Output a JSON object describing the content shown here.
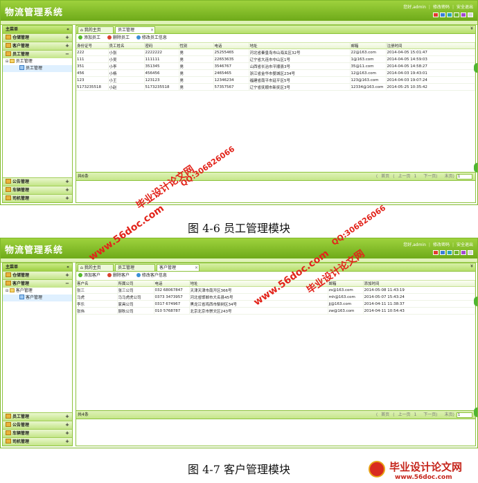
{
  "app_title": "物流管理系统",
  "top_links": {
    "welcome": "您好,admin",
    "change_password": "修改密码",
    "logout": "安全退出"
  },
  "skin_colors": [
    "#e23b2e",
    "#3b7fd9",
    "#2ba3b5",
    "#6db42b",
    "#a34ad0",
    "#d8d8d8"
  ],
  "menu_title": "主菜单",
  "menu_title_ctl": "«",
  "shot1": {
    "top_menus": [
      {
        "label": "仓储管理",
        "ctl": "+"
      },
      {
        "label": "客户管理",
        "ctl": "+"
      },
      {
        "label": "员工管理",
        "ctl": "−"
      }
    ],
    "tree": {
      "folder": "员工管理",
      "leaf": "员工管理"
    },
    "bottom_menus": [
      {
        "label": "公告管理",
        "ctl": "+"
      },
      {
        "label": "车辆管理",
        "ctl": "+"
      },
      {
        "label": "司机管理",
        "ctl": "+"
      }
    ],
    "tabs": [
      {
        "label": "我的主页"
      },
      {
        "label": "员工管理"
      }
    ],
    "toolbar": {
      "add": "添加员工",
      "delete": "删除员工",
      "edit": "修改员工信息"
    },
    "columns": [
      "身份证号",
      "员工姓名",
      "密码",
      "性别",
      "电话",
      "地址",
      "邮箱",
      "注册时间"
    ],
    "rows": [
      [
        "222",
        "小张",
        "2222222",
        "男",
        "25255465",
        "河北省秦皇岛市山海关区32号",
        "22@163.com",
        "2014-04-05 15:01:47"
      ],
      [
        "111",
        "小吴",
        "111111",
        "男",
        "22653635",
        "辽宁省大连市中山区1号",
        "1@163.com",
        "2014-04-05 14:59:03"
      ],
      [
        "351",
        "小李",
        "351345",
        "男",
        "3546767",
        "山西省长治市平顺县3号",
        "35@11.com",
        "2014-04-05 14:58:27"
      ],
      [
        "456",
        "小杨",
        "456456",
        "男",
        "2465465",
        "浙江省金华市婺城区234号",
        "12@163.com",
        "2014-04-03 19:43:01"
      ],
      [
        "123",
        "小王",
        "123123",
        "男",
        "12346234",
        "福建省南平市延平区5号",
        "123@163.com",
        "2014-04-03 19:07:24"
      ],
      [
        "5173235518",
        "小赵",
        "5173235518",
        "男",
        "57357567",
        "辽宁省抚顺市新抚区3号",
        "12334@163.com",
        "2014-05-25 10:35:42"
      ]
    ],
    "pager": {
      "total": "共6条",
      "first": "首页",
      "prev": "上一页",
      "page": "1",
      "next": "下一页",
      "last": "末页",
      "box": "1"
    }
  },
  "caption1": "图 4-6 员工管理模块",
  "shot2": {
    "top_menus": [
      {
        "label": "仓储管理",
        "ctl": "+"
      },
      {
        "label": "客户管理",
        "ctl": "−"
      }
    ],
    "tree": {
      "folder": "客户管理",
      "leaf": "客户管理"
    },
    "bottom_menus": [
      {
        "label": "员工管理",
        "ctl": "+"
      },
      {
        "label": "公告管理",
        "ctl": "+"
      },
      {
        "label": "车辆管理",
        "ctl": "+"
      },
      {
        "label": "司机管理",
        "ctl": "+"
      }
    ],
    "tabs": [
      {
        "label": "我的主页"
      },
      {
        "label": "员工管理"
      },
      {
        "label": "客户管理"
      }
    ],
    "toolbar": {
      "add": "添加客户",
      "delete": "删除客户",
      "edit": "修改客户信息"
    },
    "columns": [
      "客户名",
      "所属公司",
      "电话",
      "地址",
      "邮箱",
      "添加时间"
    ],
    "rows": [
      [
        "张三",
        "张三公司",
        "032 68067847",
        "天津天津市南开区366号",
        "zs@163.com",
        "2014-05-08 11:43:19"
      ],
      [
        "马虎",
        "马马虎虎公司",
        "0373 3473957",
        "河北省邯郸市大名县45号",
        "mh@163.com",
        "2014-05-07 15:43:24"
      ],
      [
        "李乐",
        "家具公司",
        "0317 674967",
        "黑龙江省鸡西市梨树区34号",
        "jj@163.com",
        "2014-04-11 11:38:37"
      ],
      [
        "张伟",
        "厨秋公司",
        "010 5768787",
        "北京北京市崇文区243号",
        "zw@163.com",
        "2014-04-11 10:54:43"
      ]
    ],
    "pager": {
      "total": "共4条",
      "first": "首页",
      "prev": "上一页",
      "page": "1",
      "next": "下一页",
      "last": "末页",
      "box": "1"
    }
  },
  "caption2": "图 4-7 客户管理模块",
  "watermarks": {
    "site": "www.56doc.com",
    "qq": "QQ:306826066",
    "brand": "毕业设计论文网"
  },
  "logo": {
    "main": "毕业设计论文网",
    "sub": "www.56doc.com"
  }
}
